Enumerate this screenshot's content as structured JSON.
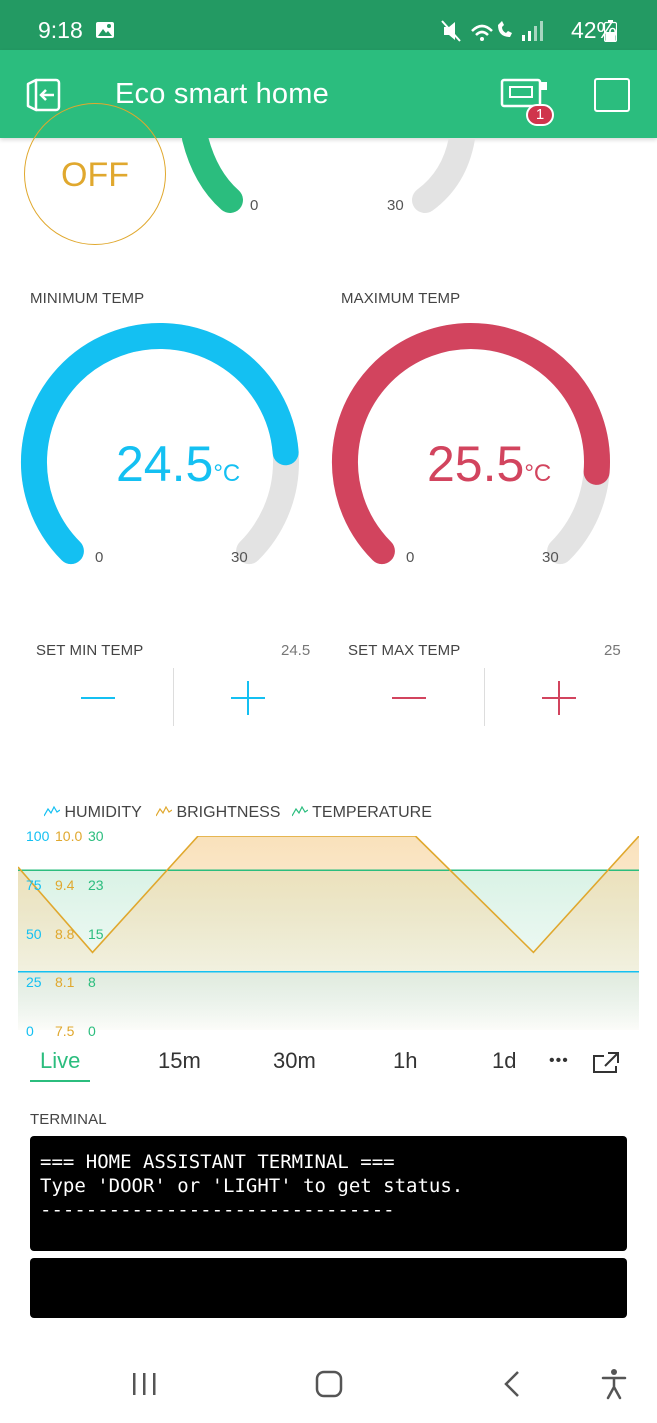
{
  "status": {
    "time": "9:18",
    "battery": "42%"
  },
  "appbar": {
    "title": "Eco smart home",
    "badge": "1"
  },
  "top_widgets": {
    "button_state": "OFF",
    "gauge1_min": "0",
    "gauge2_min": "30"
  },
  "gauges": [
    {
      "label": "MINIMUM TEMP",
      "value": "24.5",
      "unit": "°C",
      "min": "0",
      "max": "30",
      "color": "#14c0f2",
      "fraction": 0.817
    },
    {
      "label": "MAXIMUM TEMP",
      "value": "25.5",
      "unit": "°C",
      "min": "0",
      "max": "30",
      "color": "#d2445e",
      "fraction": 0.85
    }
  ],
  "steppers": [
    {
      "label": "SET MIN TEMP",
      "value": "24.5",
      "color": "#14c0f2"
    },
    {
      "label": "SET MAX TEMP",
      "value": "25",
      "color": "#d2445e"
    }
  ],
  "chart_data": {
    "type": "line",
    "legend": [
      "HUMIDITY",
      "BRIGHTNESS",
      "TEMPERATURE"
    ],
    "colors": {
      "humidity": "#14c0f2",
      "brightness": "#e0a82e",
      "temperature": "#2bbd7e"
    },
    "y_axes": {
      "humidity": [
        "100",
        "75",
        "50",
        "25",
        "0"
      ],
      "brightness": [
        "10.0",
        "9.4",
        "8.8",
        "8.1",
        "7.5"
      ],
      "temperature": [
        "30",
        "23",
        "15",
        "8",
        "0"
      ]
    },
    "series": [
      {
        "name": "HUMIDITY",
        "values": [
          30,
          30
        ]
      },
      {
        "name": "BRIGHTNESS",
        "x": [
          0,
          0.12,
          0.29,
          0.64,
          0.83,
          1.0
        ],
        "values": [
          9.6,
          8.5,
          10.0,
          10.0,
          8.5,
          10.0
        ]
      },
      {
        "name": "TEMPERATURE",
        "values": [
          24.7,
          24.7
        ]
      }
    ],
    "ylim": {
      "humidity": [
        0,
        100
      ],
      "brightness": [
        7.5,
        10.0
      ],
      "temperature": [
        0,
        30
      ]
    }
  },
  "time_tabs": [
    "Live",
    "15m",
    "30m",
    "1h",
    "1d",
    "•••"
  ],
  "terminal": {
    "label": "TERMINAL",
    "output": "=== HOME ASSISTANT TERMINAL ===\nType 'DOOR' or 'LIGHT' to get status.\n-------------------------------"
  }
}
